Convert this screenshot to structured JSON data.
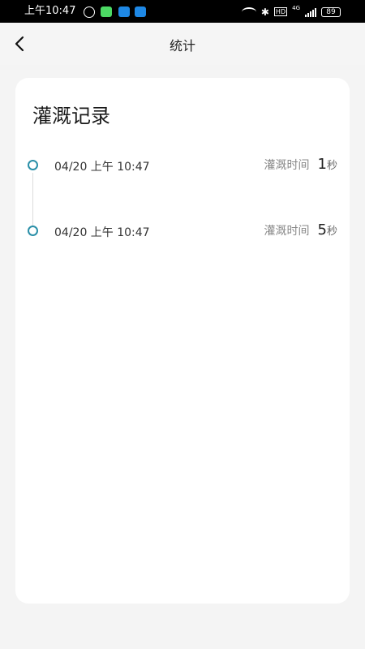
{
  "status_bar": {
    "time": "上午10:47",
    "hd": "HD",
    "network": "4G",
    "battery": "89"
  },
  "nav": {
    "title": "统计"
  },
  "card": {
    "title": "灌溉记录",
    "records": [
      {
        "date": "04/20 上午 10:47",
        "label": "灌溉时间",
        "value": "1",
        "unit": "秒"
      },
      {
        "date": "04/20 上午 10:47",
        "label": "灌溉时间",
        "value": "5",
        "unit": "秒"
      }
    ]
  }
}
